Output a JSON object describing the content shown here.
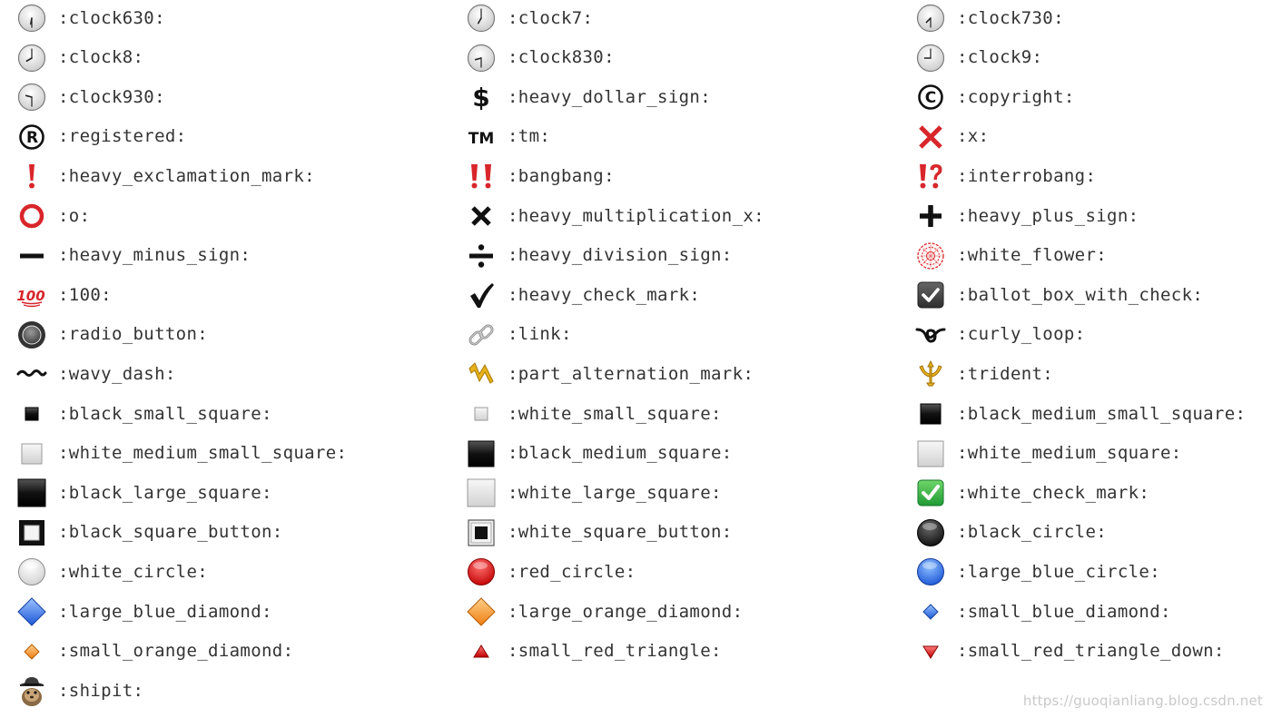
{
  "columns": [
    {
      "items": [
        {
          "label": ":clock630:",
          "icon": "clock-630-icon"
        },
        {
          "label": ":clock8:",
          "icon": "clock-8-icon"
        },
        {
          "label": ":clock930:",
          "icon": "clock-930-icon"
        },
        {
          "label": ":registered:",
          "icon": "registered-icon"
        },
        {
          "label": ":heavy_exclamation_mark:",
          "icon": "heavy-exclamation-mark-icon"
        },
        {
          "label": ":o:",
          "icon": "o-icon"
        },
        {
          "label": ":heavy_minus_sign:",
          "icon": "heavy-minus-sign-icon"
        },
        {
          "label": ":100:",
          "icon": "hundred-icon"
        },
        {
          "label": ":radio_button:",
          "icon": "radio-button-icon"
        },
        {
          "label": ":wavy_dash:",
          "icon": "wavy-dash-icon"
        },
        {
          "label": ":black_small_square:",
          "icon": "black-small-square-icon"
        },
        {
          "label": ":white_medium_small_square:",
          "icon": "white-medium-small-square-icon"
        },
        {
          "label": ":black_large_square:",
          "icon": "black-large-square-icon"
        },
        {
          "label": ":black_square_button:",
          "icon": "black-square-button-icon"
        },
        {
          "label": ":white_circle:",
          "icon": "white-circle-icon"
        },
        {
          "label": ":large_blue_diamond:",
          "icon": "large-blue-diamond-icon"
        },
        {
          "label": ":small_orange_diamond:",
          "icon": "small-orange-diamond-icon"
        },
        {
          "label": ":shipit:",
          "icon": "shipit-icon"
        }
      ]
    },
    {
      "items": [
        {
          "label": ":clock7:",
          "icon": "clock-7-icon"
        },
        {
          "label": ":clock830:",
          "icon": "clock-830-icon"
        },
        {
          "label": ":heavy_dollar_sign:",
          "icon": "heavy-dollar-sign-icon"
        },
        {
          "label": ":tm:",
          "icon": "tm-icon"
        },
        {
          "label": ":bangbang:",
          "icon": "bangbang-icon"
        },
        {
          "label": ":heavy_multiplication_x:",
          "icon": "heavy-multiplication-x-icon"
        },
        {
          "label": ":heavy_division_sign:",
          "icon": "heavy-division-sign-icon"
        },
        {
          "label": ":heavy_check_mark:",
          "icon": "heavy-check-mark-icon"
        },
        {
          "label": ":link:",
          "icon": "link-icon"
        },
        {
          "label": ":part_alternation_mark:",
          "icon": "part-alternation-mark-icon"
        },
        {
          "label": ":white_small_square:",
          "icon": "white-small-square-icon"
        },
        {
          "label": ":black_medium_square:",
          "icon": "black-medium-square-icon"
        },
        {
          "label": ":white_large_square:",
          "icon": "white-large-square-icon"
        },
        {
          "label": ":white_square_button:",
          "icon": "white-square-button-icon"
        },
        {
          "label": ":red_circle:",
          "icon": "red-circle-icon"
        },
        {
          "label": ":large_orange_diamond:",
          "icon": "large-orange-diamond-icon"
        },
        {
          "label": ":small_red_triangle:",
          "icon": "small-red-triangle-icon"
        }
      ]
    },
    {
      "items": [
        {
          "label": ":clock730:",
          "icon": "clock-730-icon"
        },
        {
          "label": ":clock9:",
          "icon": "clock-9-icon"
        },
        {
          "label": ":copyright:",
          "icon": "copyright-icon"
        },
        {
          "label": ":x:",
          "icon": "x-icon"
        },
        {
          "label": ":interrobang:",
          "icon": "interrobang-icon"
        },
        {
          "label": ":heavy_plus_sign:",
          "icon": "heavy-plus-sign-icon"
        },
        {
          "label": ":white_flower:",
          "icon": "white-flower-icon"
        },
        {
          "label": ":ballot_box_with_check:",
          "icon": "ballot-box-with-check-icon"
        },
        {
          "label": ":curly_loop:",
          "icon": "curly-loop-icon"
        },
        {
          "label": ":trident:",
          "icon": "trident-icon"
        },
        {
          "label": ":black_medium_small_square:",
          "icon": "black-medium-small-square-icon"
        },
        {
          "label": ":white_medium_square:",
          "icon": "white-medium-square-icon"
        },
        {
          "label": ":white_check_mark:",
          "icon": "white-check-mark-icon"
        },
        {
          "label": ":black_circle:",
          "icon": "black-circle-icon"
        },
        {
          "label": ":large_blue_circle:",
          "icon": "large-blue-circle-icon"
        },
        {
          "label": ":small_blue_diamond:",
          "icon": "small-blue-diamond-icon"
        },
        {
          "label": ":small_red_triangle_down:",
          "icon": "small-red-triangle-down-icon"
        }
      ]
    }
  ],
  "watermark": "https://guoqianliang.blog.csdn.net",
  "colors": {
    "text": "#333333",
    "watermark": "#c9c9c9",
    "red": "#d8262b",
    "blue": "#2a6ee6",
    "orange": "#f39a2b",
    "green": "#39b54a",
    "gold": "#d4a017"
  }
}
